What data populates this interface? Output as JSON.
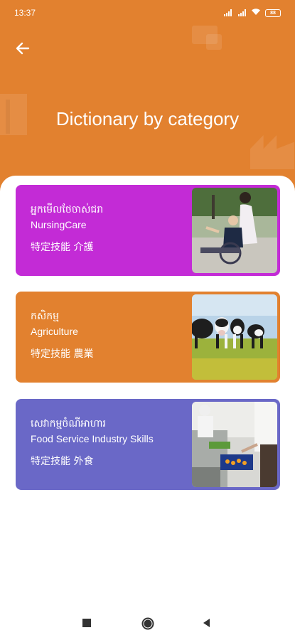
{
  "status_bar": {
    "time": "13:37",
    "battery": "88",
    "icons": [
      "signal-icon",
      "signal-icon",
      "wifi-icon",
      "battery-icon"
    ]
  },
  "header": {
    "title": "Dictionary by category",
    "back_icon": "arrow-left-icon",
    "color": "#E2812F"
  },
  "categories": [
    {
      "khmer": "អ្នកមើលថែចាស់ជរា",
      "english": "NursingCare",
      "japanese": "特定技能 介護",
      "color": "#C32BD6",
      "photo": "nursing-care-photo"
    },
    {
      "khmer": "កសិកម្ម",
      "english": "Agriculture",
      "japanese": "特定技能 農業",
      "color": "#E2812F",
      "photo": "agriculture-cows-photo"
    },
    {
      "khmer": "សេវាកម្មចំណីអាហារ",
      "english": "Food Service Industry Skills",
      "japanese": "特定技能 外食",
      "color": "#6A68C7",
      "photo": "food-service-kitchen-photo"
    }
  ],
  "nav_bar": {
    "icons": [
      "recents-square-icon",
      "home-circle-icon",
      "back-triangle-icon"
    ]
  }
}
